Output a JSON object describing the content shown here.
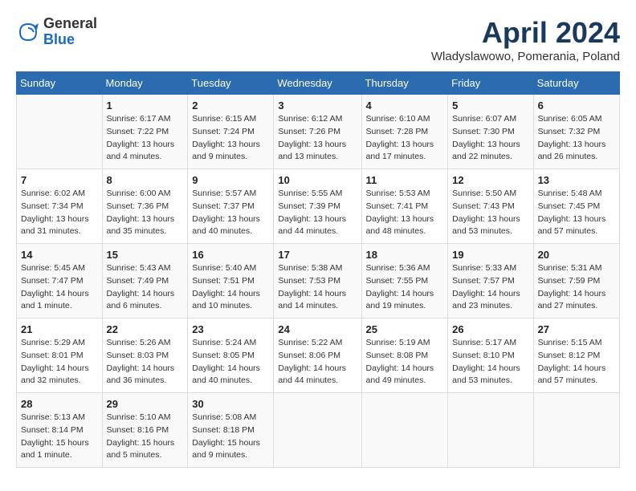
{
  "header": {
    "logo_general": "General",
    "logo_blue": "Blue",
    "month_title": "April 2024",
    "location": "Wladyslawowo, Pomerania, Poland"
  },
  "weekdays": [
    "Sunday",
    "Monday",
    "Tuesday",
    "Wednesday",
    "Thursday",
    "Friday",
    "Saturday"
  ],
  "weeks": [
    [
      {
        "day": "",
        "info": ""
      },
      {
        "day": "1",
        "info": "Sunrise: 6:17 AM\nSunset: 7:22 PM\nDaylight: 13 hours\nand 4 minutes."
      },
      {
        "day": "2",
        "info": "Sunrise: 6:15 AM\nSunset: 7:24 PM\nDaylight: 13 hours\nand 9 minutes."
      },
      {
        "day": "3",
        "info": "Sunrise: 6:12 AM\nSunset: 7:26 PM\nDaylight: 13 hours\nand 13 minutes."
      },
      {
        "day": "4",
        "info": "Sunrise: 6:10 AM\nSunset: 7:28 PM\nDaylight: 13 hours\nand 17 minutes."
      },
      {
        "day": "5",
        "info": "Sunrise: 6:07 AM\nSunset: 7:30 PM\nDaylight: 13 hours\nand 22 minutes."
      },
      {
        "day": "6",
        "info": "Sunrise: 6:05 AM\nSunset: 7:32 PM\nDaylight: 13 hours\nand 26 minutes."
      }
    ],
    [
      {
        "day": "7",
        "info": "Sunrise: 6:02 AM\nSunset: 7:34 PM\nDaylight: 13 hours\nand 31 minutes."
      },
      {
        "day": "8",
        "info": "Sunrise: 6:00 AM\nSunset: 7:36 PM\nDaylight: 13 hours\nand 35 minutes."
      },
      {
        "day": "9",
        "info": "Sunrise: 5:57 AM\nSunset: 7:37 PM\nDaylight: 13 hours\nand 40 minutes."
      },
      {
        "day": "10",
        "info": "Sunrise: 5:55 AM\nSunset: 7:39 PM\nDaylight: 13 hours\nand 44 minutes."
      },
      {
        "day": "11",
        "info": "Sunrise: 5:53 AM\nSunset: 7:41 PM\nDaylight: 13 hours\nand 48 minutes."
      },
      {
        "day": "12",
        "info": "Sunrise: 5:50 AM\nSunset: 7:43 PM\nDaylight: 13 hours\nand 53 minutes."
      },
      {
        "day": "13",
        "info": "Sunrise: 5:48 AM\nSunset: 7:45 PM\nDaylight: 13 hours\nand 57 minutes."
      }
    ],
    [
      {
        "day": "14",
        "info": "Sunrise: 5:45 AM\nSunset: 7:47 PM\nDaylight: 14 hours\nand 1 minute."
      },
      {
        "day": "15",
        "info": "Sunrise: 5:43 AM\nSunset: 7:49 PM\nDaylight: 14 hours\nand 6 minutes."
      },
      {
        "day": "16",
        "info": "Sunrise: 5:40 AM\nSunset: 7:51 PM\nDaylight: 14 hours\nand 10 minutes."
      },
      {
        "day": "17",
        "info": "Sunrise: 5:38 AM\nSunset: 7:53 PM\nDaylight: 14 hours\nand 14 minutes."
      },
      {
        "day": "18",
        "info": "Sunrise: 5:36 AM\nSunset: 7:55 PM\nDaylight: 14 hours\nand 19 minutes."
      },
      {
        "day": "19",
        "info": "Sunrise: 5:33 AM\nSunset: 7:57 PM\nDaylight: 14 hours\nand 23 minutes."
      },
      {
        "day": "20",
        "info": "Sunrise: 5:31 AM\nSunset: 7:59 PM\nDaylight: 14 hours\nand 27 minutes."
      }
    ],
    [
      {
        "day": "21",
        "info": "Sunrise: 5:29 AM\nSunset: 8:01 PM\nDaylight: 14 hours\nand 32 minutes."
      },
      {
        "day": "22",
        "info": "Sunrise: 5:26 AM\nSunset: 8:03 PM\nDaylight: 14 hours\nand 36 minutes."
      },
      {
        "day": "23",
        "info": "Sunrise: 5:24 AM\nSunset: 8:05 PM\nDaylight: 14 hours\nand 40 minutes."
      },
      {
        "day": "24",
        "info": "Sunrise: 5:22 AM\nSunset: 8:06 PM\nDaylight: 14 hours\nand 44 minutes."
      },
      {
        "day": "25",
        "info": "Sunrise: 5:19 AM\nSunset: 8:08 PM\nDaylight: 14 hours\nand 49 minutes."
      },
      {
        "day": "26",
        "info": "Sunrise: 5:17 AM\nSunset: 8:10 PM\nDaylight: 14 hours\nand 53 minutes."
      },
      {
        "day": "27",
        "info": "Sunrise: 5:15 AM\nSunset: 8:12 PM\nDaylight: 14 hours\nand 57 minutes."
      }
    ],
    [
      {
        "day": "28",
        "info": "Sunrise: 5:13 AM\nSunset: 8:14 PM\nDaylight: 15 hours\nand 1 minute."
      },
      {
        "day": "29",
        "info": "Sunrise: 5:10 AM\nSunset: 8:16 PM\nDaylight: 15 hours\nand 5 minutes."
      },
      {
        "day": "30",
        "info": "Sunrise: 5:08 AM\nSunset: 8:18 PM\nDaylight: 15 hours\nand 9 minutes."
      },
      {
        "day": "",
        "info": ""
      },
      {
        "day": "",
        "info": ""
      },
      {
        "day": "",
        "info": ""
      },
      {
        "day": "",
        "info": ""
      }
    ]
  ]
}
